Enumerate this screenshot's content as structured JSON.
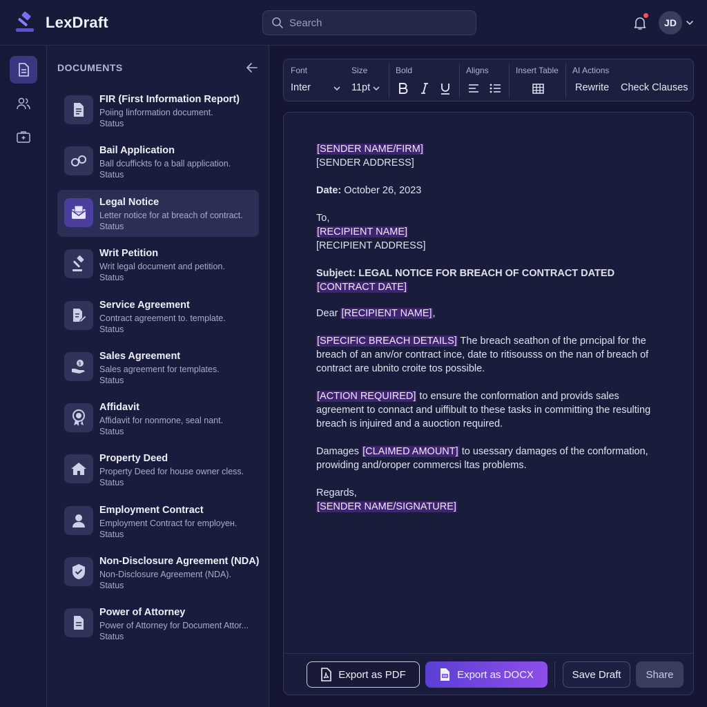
{
  "app": {
    "name": "LexDraft",
    "search_placeholder": "Search",
    "user_initials": "JD"
  },
  "sidebar": {
    "header": "DOCUMENTS",
    "items": [
      {
        "title": "FIR (First Information Report)",
        "desc": "Poiing linformation document.",
        "status": "Status",
        "icon": "document-lines-icon"
      },
      {
        "title": "Bail Application",
        "desc": "Ball dcuffickts fo a ball application.",
        "status": "Status",
        "icon": "handcuffs-icon"
      },
      {
        "title": "Legal Notice",
        "desc": "Letter notice for at breach of contract.",
        "status": "Status",
        "icon": "envelope-icon"
      },
      {
        "title": "Writ Petition",
        "desc": "Writ legal document and petition.",
        "status": "Status",
        "icon": "gavel-icon"
      },
      {
        "title": "Service Agreement",
        "desc": "Contract agreement to. template.",
        "status": "Status",
        "icon": "document-edit-icon"
      },
      {
        "title": "Sales Agreement",
        "desc": "Sales agreement for templates.",
        "status": "Status",
        "icon": "money-hand-icon"
      },
      {
        "title": "Affidavit",
        "desc": "Affidavit for nonmone, seal nant.",
        "status": "Status",
        "icon": "seal-icon"
      },
      {
        "title": "Property Deed",
        "desc": "Property Deed for house owner cless.",
        "status": "Status",
        "icon": "house-icon"
      },
      {
        "title": "Employment Contract",
        "desc": "Employment Contract for employeн.",
        "status": "Status",
        "icon": "user-icon"
      },
      {
        "title": "Non-Disclosure Agreement (NDA)",
        "desc": "Non-Disclosure Agreement (NDA).",
        "status": "Status",
        "icon": "shield-check-icon"
      },
      {
        "title": "Power of Attorney",
        "desc": "Power of Attorney for Document Attor...",
        "status": "Status",
        "icon": "document-icon"
      }
    ]
  },
  "toolbar": {
    "font_label": "Font",
    "font_value": "Inter",
    "size_label": "Size",
    "size_value": "11pt",
    "bold_label": "Bold",
    "aligns_label": "Aligns",
    "table_label": "Insert Table",
    "ai_label": "AI Actions",
    "rewrite": "Rewrite",
    "check_clauses": "Check Clauses"
  },
  "letter": {
    "sender_name": "[SENDER NAME/FIRM]",
    "sender_address": "[SENDER ADDRESS]",
    "date_label": "Date:",
    "date_value": " October 26, 2023",
    "to": "To,",
    "recipient_name": "[RECIPIENT NAME]",
    "recipient_address": "[RECIPIENT ADDRESS]",
    "subject_text": "Subject: LEGAL NOTICE FOR BREACH OF CONTRACT DATED ",
    "subject_ph": "[CONTRACT DATE]",
    "dear": "Dear ",
    "dear_ph": "[RECIPIENT NAME]",
    "dear_tail": ",",
    "p1_ph": "[SPECIFIC BREACH DETAILS]",
    "p1_text": " The breach seathon of the prncipal for the breach of an anv/or contract ince, date to ritisousss on the nan of breach of contract are ubnito croite tos possible.",
    "p2_ph": "[ACTION REQUIRED]",
    "p2_text": " to ensure the conformation and provids sales agreement to connact and uiffibult to these tasks in committing the resulting breach is injuired and a auoction required.",
    "p3_pre": "Damages ",
    "p3_ph": "[CLAIMED AMOUNT]",
    "p3_text": " to usessary damages of the conformation, prowiding and/oroper commercsi ltas problems.",
    "regards": "Regards,",
    "signature": "[SENDER NAME/SIGNATURE]"
  },
  "actions": {
    "export_pdf": "Export as PDF",
    "export_docx": "Export as DOCX",
    "save_draft": "Save Draft",
    "share": "Share"
  },
  "colors": {
    "accent": "#5b3fd6",
    "placeholder_highlight": "#3f2470",
    "background": "#141633"
  }
}
